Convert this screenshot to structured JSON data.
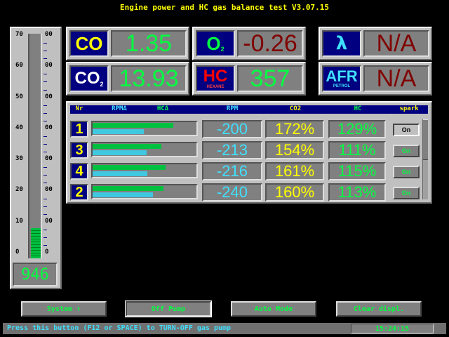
{
  "title": "Engine power and HC gas balance test  V3.07.15",
  "gauge": {
    "scale_left": [
      "70",
      "60",
      "50",
      "40",
      "30",
      "20",
      "10",
      "0"
    ],
    "scale_right": [
      "00",
      "00",
      "00",
      "00",
      "00",
      "00",
      "00",
      "0"
    ],
    "level_fraction": 0.135,
    "readout": "946"
  },
  "readings": {
    "co": {
      "label": "CO",
      "value": "1.35"
    },
    "o2": {
      "label": "O",
      "sub": "2",
      "value": "-0.26"
    },
    "lambda": {
      "label": "λ",
      "value": "N/A"
    },
    "co2": {
      "label": "CO",
      "sub": "2",
      "value": "13.93"
    },
    "hc": {
      "label": "HC",
      "sub": "HEXANE",
      "value": "357"
    },
    "afr": {
      "label": "AFR",
      "sub": "PETROL",
      "value": "N/A"
    }
  },
  "table": {
    "headers": {
      "nr": "Nr",
      "rpm_delta": "RPMΔ",
      "hc_delta": "HCΔ",
      "rpm": "RPM",
      "co2": "CO2",
      "hc": "HC",
      "spark": "spark"
    },
    "rows": [
      {
        "nr": "1",
        "rpm_bar": 0.78,
        "hc_bar": 0.49,
        "rpm": "-200",
        "co2": "172%",
        "hc": "129%",
        "spark": "On",
        "active": true
      },
      {
        "nr": "3",
        "rpm_bar": 0.66,
        "hc_bar": 0.52,
        "rpm": "-213",
        "co2": "154%",
        "hc": "111%",
        "spark": "On",
        "active": false
      },
      {
        "nr": "4",
        "rpm_bar": 0.7,
        "hc_bar": 0.53,
        "rpm": "-216",
        "co2": "161%",
        "hc": "115%",
        "spark": "On",
        "active": false
      },
      {
        "nr": "2",
        "rpm_bar": 0.68,
        "hc_bar": 0.58,
        "rpm": "-240",
        "co2": "160%",
        "hc": "113%",
        "spark": "On",
        "active": false
      }
    ]
  },
  "buttons": {
    "system": "System ↑",
    "off_pump": "Off Pump",
    "auto_mode": "Auto Mode",
    "clear_displ": "Clear displ."
  },
  "status": {
    "message": "Press this button (F12 or SPACE) to TURN-OFF gas pump",
    "time": "15:24:15"
  },
  "colors": {
    "navy": "#000080",
    "green": "#00ff40",
    "yellow": "#ffff00",
    "cyan": "#40e0ff",
    "red": "#800000"
  }
}
